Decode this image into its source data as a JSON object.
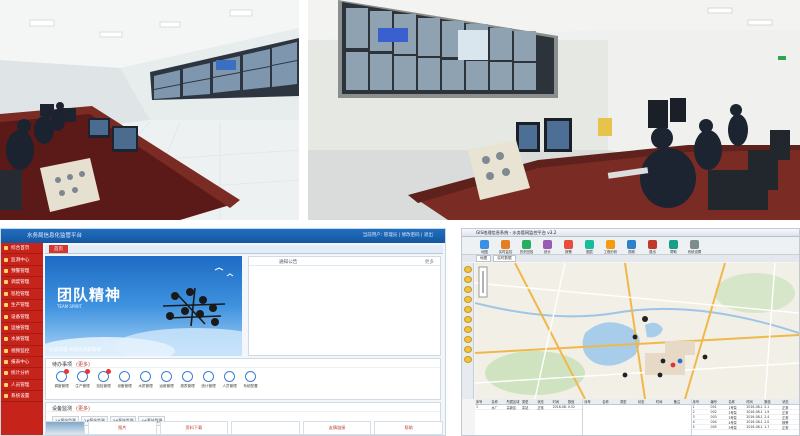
{
  "photos": {
    "top_left": {
      "alt": ""
    },
    "top_right": {
      "alt": ""
    }
  },
  "portal": {
    "title": "水务局信息化监管平台",
    "top_right_text": "当前用户: 管理员 | 修改密码 | 退出",
    "active_tab": "首页",
    "sidebar_items": [
      "综合首页",
      "监测中心",
      "预警管理",
      "调度管理",
      "巡检管理",
      "生产管理",
      "设备管理",
      "运维管理",
      "水质管理",
      "视频监控",
      "报表中心",
      "统计分析",
      "人员管理",
      "系统设置"
    ],
    "banner_title": "团队精神",
    "banner_sub": "TEAM SPIRIT",
    "banner_caption": "众志成城·共创水务新篇章",
    "notice_title": "通知公告",
    "notice_more": "更多",
    "business_title": "待办事项",
    "business_more": "(更多)",
    "business_icons": [
      "调度管理",
      "生产管理",
      "巡检管理",
      "设备管理",
      "水质管理",
      "运维管理",
      "报表管理",
      "统计管理",
      "人员管理",
      "系统配置"
    ],
    "monitor_title": "设备监测",
    "monitor_more": "(更多)",
    "monitor_buttons": [
      "1#泵站监测",
      "2#泵站监测",
      "3#泵站监测",
      "4#泵站监测"
    ],
    "bottom_strip": [
      "图片",
      "资料下载",
      "",
      "友情链接",
      "帮助"
    ],
    "colors": {
      "sidebar": "#c6231b",
      "topbar": "#1656a0",
      "accent": "#d2382f"
    }
  },
  "gis": {
    "title": "GIS地理信息系统 - 水务管网监控平台 v3.2",
    "tools": [
      "地图",
      "实时监控",
      "历史回放",
      "统计",
      "报警",
      "图层",
      "工程分析",
      "视频",
      "退出",
      "帮助",
      "系统设置"
    ],
    "tabs": [
      "地图",
      "实时数据"
    ],
    "table_left_headers": [
      "序号",
      "名称",
      "所属区域",
      "类型",
      "状态",
      "时间",
      "数值"
    ],
    "table_left_rows": [
      [
        "1",
        "水厂",
        "高新区",
        "泵站",
        "正常",
        "2016-08-13",
        "0.52"
      ]
    ],
    "table_mid_headers": [
      "序号",
      "名称",
      "类型",
      "状态",
      "时间",
      "备注"
    ],
    "table_right_headers": [
      "序号",
      "编号",
      "名称",
      "时间",
      "数值",
      "状态"
    ],
    "table_right_rows": [
      [
        "1",
        "001",
        "1号泵",
        "2016-08-13",
        "2.1",
        "正常"
      ],
      [
        "2",
        "002",
        "2号泵",
        "2016-08-13",
        "1.9",
        "正常"
      ],
      [
        "3",
        "003",
        "3号泵",
        "2016-08-13",
        "2.4",
        "正常"
      ],
      [
        "4",
        "004",
        "4号泵",
        "2016-08-13",
        "2.0",
        "报警"
      ],
      [
        "5",
        "005",
        "5号泵",
        "2016-08-13",
        "1.7",
        "正常"
      ]
    ],
    "tool_colors": [
      "#3a8ee6",
      "#e67e22",
      "#27ae60",
      "#9b59b6",
      "#e74c3c",
      "#1abc9c",
      "#f39c12",
      "#2c82c9",
      "#c0392b",
      "#16a085",
      "#7f8c8d"
    ]
  }
}
